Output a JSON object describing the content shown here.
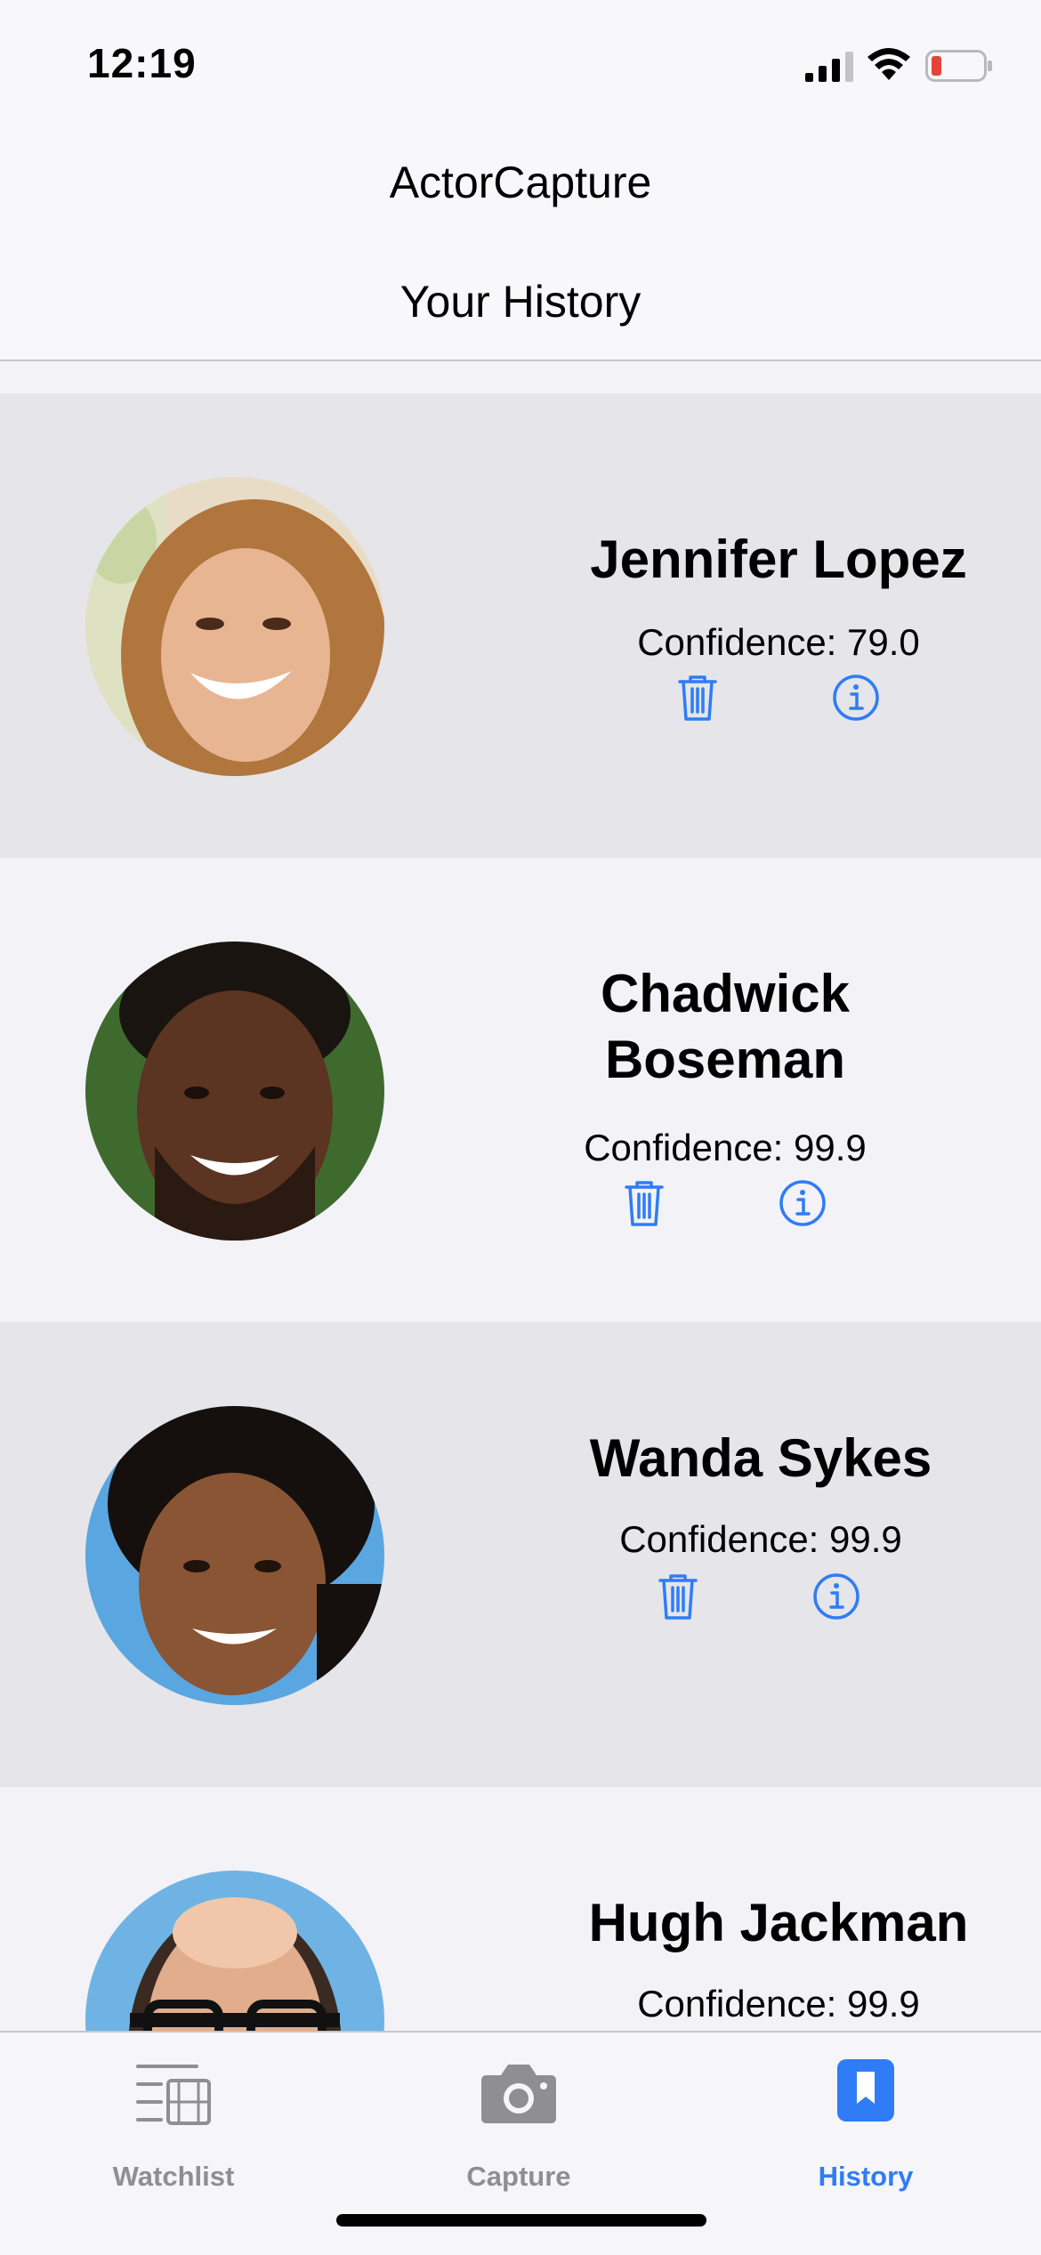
{
  "status_bar": {
    "time": "12:19"
  },
  "nav": {
    "app_title": "ActorCapture",
    "page_title": "Your History"
  },
  "history": [
    {
      "name": "Jennifer Lopez",
      "confidence_text": "Confidence: 79.0"
    },
    {
      "name": "Chadwick Boseman",
      "confidence_text": "Confidence: 99.9"
    },
    {
      "name": "Wanda Sykes",
      "confidence_text": "Confidence: 99.9"
    },
    {
      "name": "Hugh Jackman",
      "confidence_text": "Confidence: 99.9"
    }
  ],
  "tabs": [
    {
      "label": "Watchlist",
      "icon": "watchlist-icon",
      "active": false
    },
    {
      "label": "Capture",
      "icon": "camera-icon",
      "active": false
    },
    {
      "label": "History",
      "icon": "bookmark-icon",
      "active": true
    }
  ],
  "colors": {
    "accent": "#2f7cf6",
    "inactive": "#8e8e93",
    "row_dark": "#e5e5ea",
    "row_light": "#f2f2f7",
    "battery_low": "#e5443a"
  }
}
